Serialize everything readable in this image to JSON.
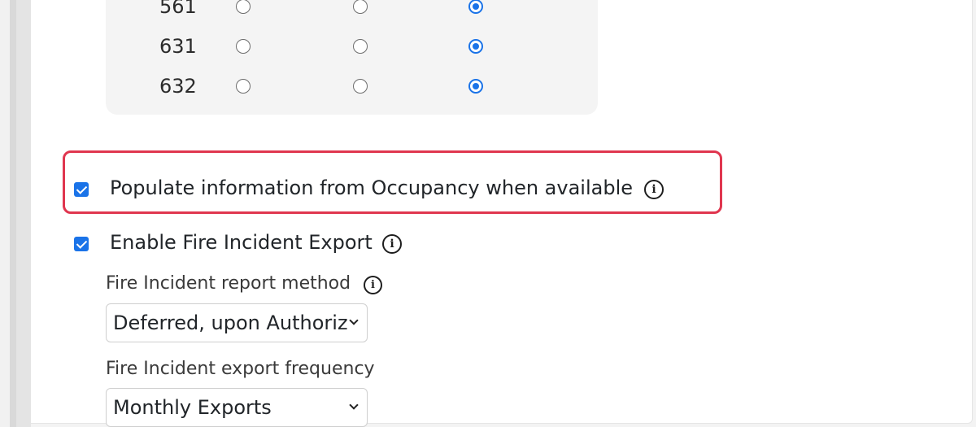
{
  "radio_table": {
    "rows": [
      {
        "label": "561",
        "selected": 3
      },
      {
        "label": "631",
        "selected": 3
      },
      {
        "label": "632",
        "selected": 3
      }
    ]
  },
  "options": {
    "populate_occupancy": {
      "label": "Populate information from Occupancy when available",
      "checked": true,
      "info_icon": "info-icon"
    },
    "enable_fire_export": {
      "label": "Enable Fire Incident Export",
      "checked": true,
      "info_icon": "info-icon"
    }
  },
  "fire_report_method": {
    "label": "Fire Incident report method",
    "value": "Deferred, upon Authorization",
    "info_icon": "info-icon"
  },
  "fire_export_frequency": {
    "label": "Fire Incident export frequency",
    "value": "Monthly Exports"
  },
  "colors": {
    "accent": "#1a73e8",
    "highlight": "#e0364f"
  }
}
